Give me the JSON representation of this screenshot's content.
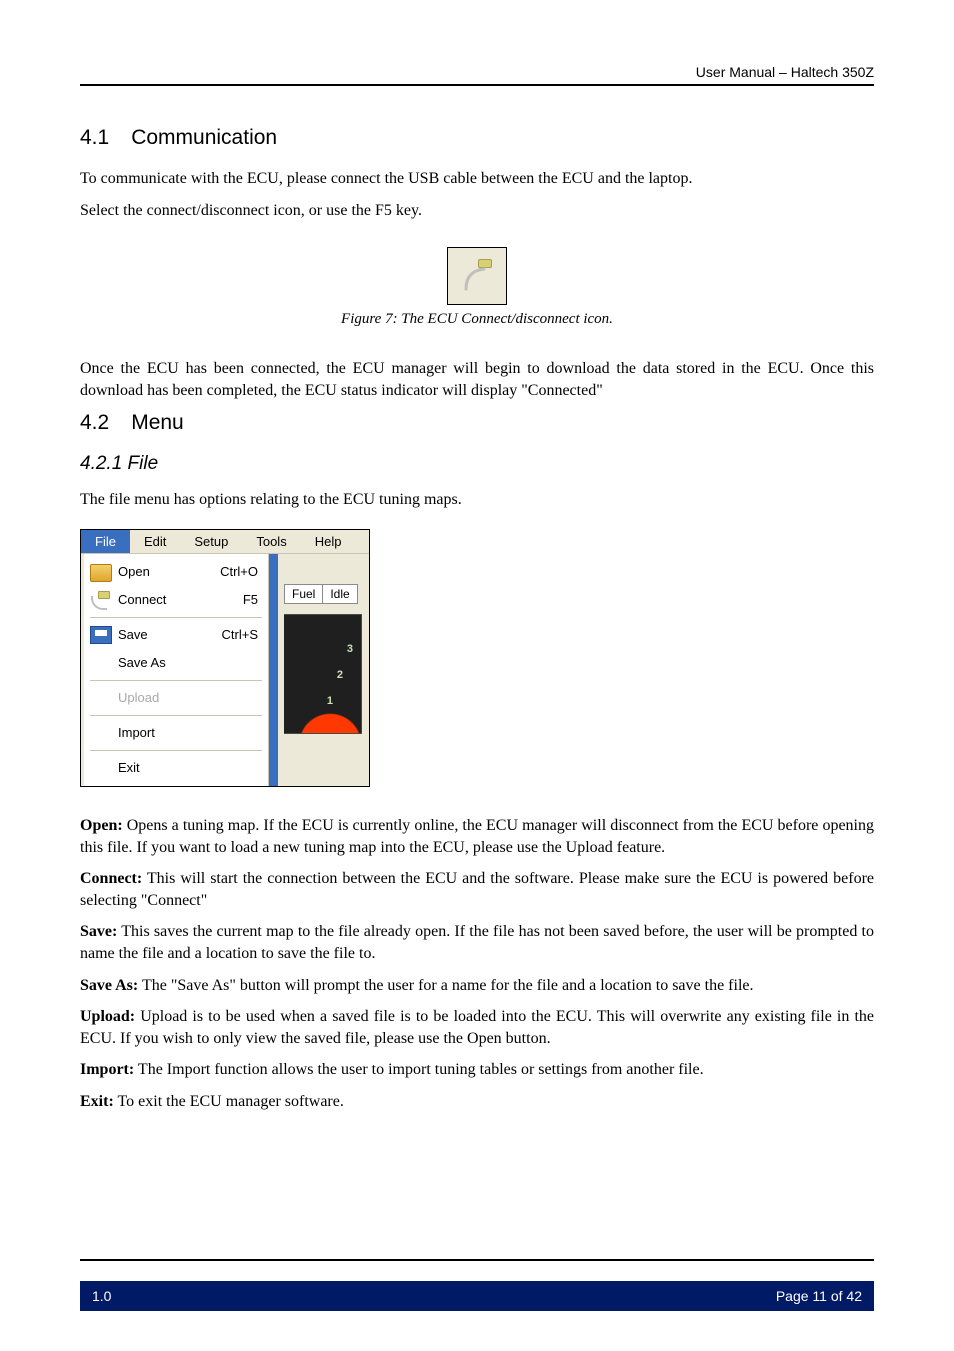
{
  "header": {
    "right": "User Manual – Haltech 350Z"
  },
  "section41": {
    "num": "4.1",
    "title": "Communication",
    "p1": "To communicate with the ECU, please connect the USB cable between the ECU and the laptop.",
    "p2": "Select the connect/disconnect icon, or use the F5 key.",
    "figcap": "Figure 7: The ECU Connect/disconnect icon.",
    "p3": "Once the ECU has been connected, the ECU manager will begin to download the data stored in the ECU. Once this download has been completed, the ECU status indicator will display \"Connected\""
  },
  "section42": {
    "num": "4.2",
    "title": "Menu"
  },
  "section421": {
    "num": "4.2.1",
    "title": "File",
    "p1": "The file menu has options relating to the ECU tuning maps."
  },
  "menu": {
    "bar": [
      "File",
      "Edit",
      "Setup",
      "Tools",
      "Help"
    ],
    "items": [
      {
        "label": "Open",
        "accel": "Ctrl+O",
        "icon": "open"
      },
      {
        "label": "Connect",
        "accel": "F5",
        "icon": "connect"
      },
      {
        "sep": true
      },
      {
        "label": "Save",
        "accel": "Ctrl+S",
        "icon": "save"
      },
      {
        "label": "Save As",
        "accel": ""
      },
      {
        "sep": true
      },
      {
        "label": "Upload",
        "accel": "",
        "disabled": true
      },
      {
        "sep": true
      },
      {
        "label": "Import",
        "accel": ""
      },
      {
        "sep": true
      },
      {
        "label": "Exit",
        "accel": ""
      }
    ],
    "tabs": [
      "Fuel",
      "Idle"
    ],
    "gauge_ticks": [
      "3",
      "2",
      "1"
    ]
  },
  "defs": {
    "open": {
      "t": "Open:",
      "b": " Opens a tuning map. If the ECU is currently online, the ECU manager will disconnect from the ECU before opening this file. If you want to load a new tuning map into the ECU, please use the Upload feature."
    },
    "connect": {
      "t": "Connect:",
      "b": " This will start the connection between the ECU and the software. Please make sure the ECU is powered before selecting \"Connect\""
    },
    "save": {
      "t": "Save:",
      "b": " This saves the current map to the file already open. If the file has not been saved before, the user will be prompted to name the file and a location to save the file to."
    },
    "saveas": {
      "t": "Save As:",
      "b": " The \"Save As\" button will prompt the user for a name for the file and a location to save the file."
    },
    "upload": {
      "t": "Upload:",
      "b": " Upload is to be used when a saved file is to be loaded into the ECU. This will overwrite any existing file in the ECU. If you wish to only view the saved file, please use the Open button."
    },
    "import": {
      "t": "Import:",
      "b": " The Import function allows the user to import tuning tables or settings from another file."
    },
    "exit": {
      "t": "Exit:",
      "b": " To exit the ECU manager software."
    }
  },
  "footer": {
    "left": "1.0",
    "right": "Page 11 of 42"
  }
}
